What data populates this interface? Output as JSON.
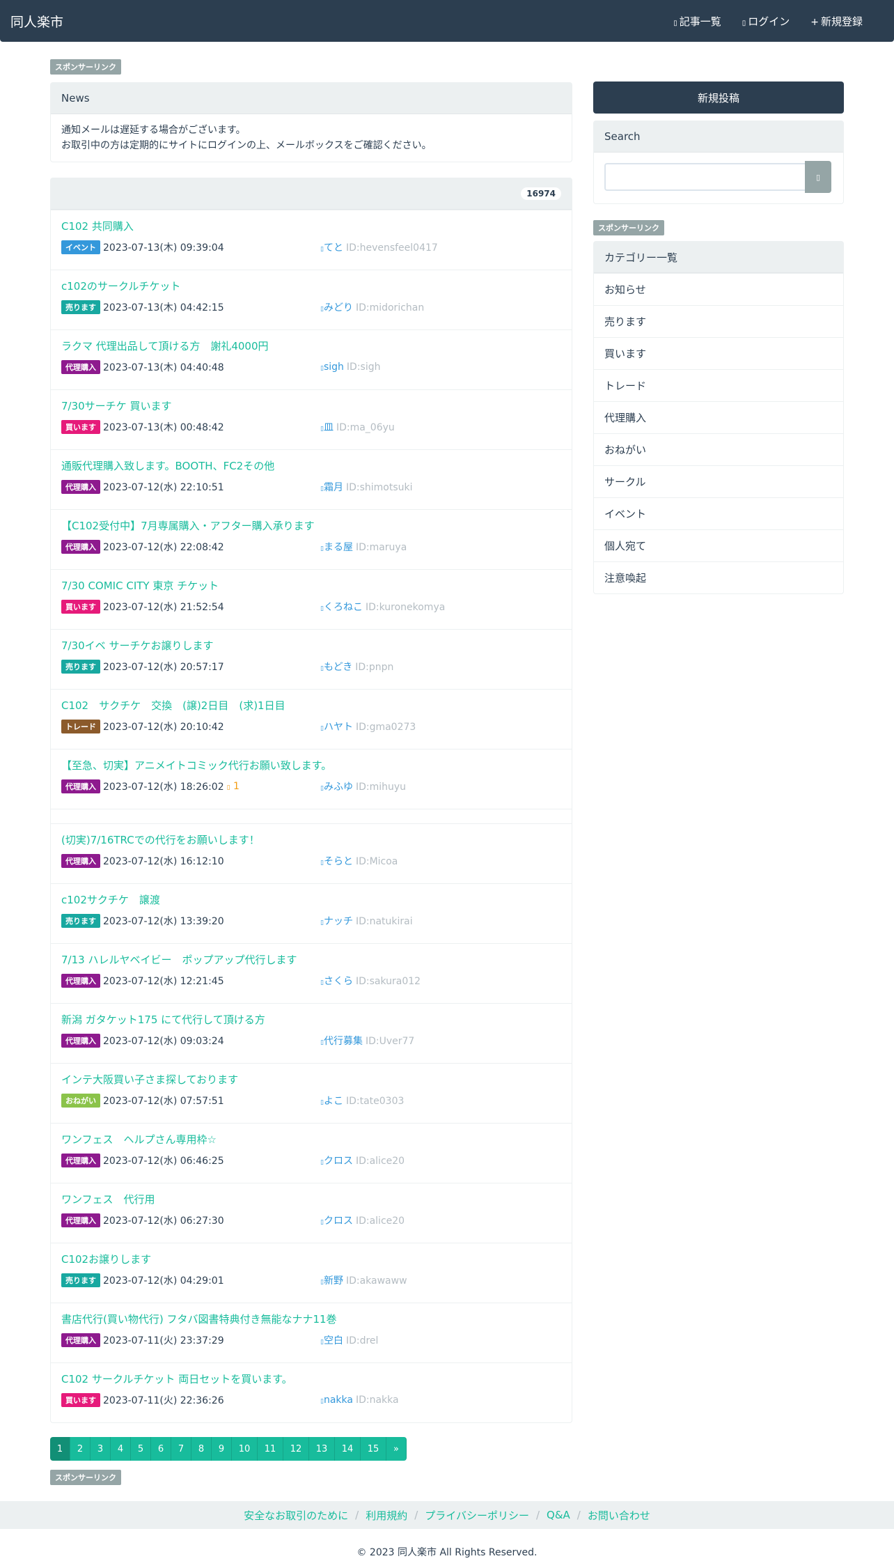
{
  "site": {
    "brand": "同人楽市"
  },
  "nav": [
    {
      "icon": "list-icon",
      "label": "記事一覧"
    },
    {
      "icon": "login-icon",
      "label": "ログイン"
    },
    {
      "icon": "plus-icon",
      "label": "新規登録"
    }
  ],
  "sponsor_label": "スポンサーリンク",
  "news": {
    "title": "News",
    "lines": [
      "通知メールは遅延する場合がございます。",
      "お取引中の方は定期的にサイトにログインの上、メールボックスをご確認ください。"
    ]
  },
  "post_count": "16974",
  "colors": {
    "event": "#3498db",
    "sell": "#18a8a0",
    "proxy": "#8e1a8e",
    "buy": "#e61a7a",
    "trade": "#8b5a2b",
    "wish": "#8bc34a",
    "primary": "#2c3e50",
    "accent": "#18bc9c"
  },
  "posts": [
    {
      "title": "C102 共同購入",
      "category": "イベント",
      "cat": "event",
      "date": "2023-07-13(木) 09:39:04",
      "user": "てと",
      "id": "ID:hevensfeel0417"
    },
    {
      "title": "c102のサークルチケット",
      "category": "売ります",
      "cat": "sell",
      "date": "2023-07-13(木) 04:42:15",
      "user": "みどり",
      "id": "ID:midorichan"
    },
    {
      "title": "ラクマ 代理出品して頂ける方　謝礼4000円",
      "category": "代理購入",
      "cat": "proxy",
      "date": "2023-07-13(木) 04:40:48",
      "user": "sigh",
      "id": "ID:sigh"
    },
    {
      "title": "7/30サーチケ 買います",
      "category": "買います",
      "cat": "buy",
      "date": "2023-07-13(木) 00:48:42",
      "user": "皿",
      "id": "ID:ma_06yu"
    },
    {
      "title": "通販代理購入致します。BOOTH、FC2その他",
      "category": "代理購入",
      "cat": "proxy",
      "date": "2023-07-12(水) 22:10:51",
      "user": "霜月",
      "id": "ID:shimotsuki"
    },
    {
      "title": "【C102受付中】7月専属購入・アフター購入承ります",
      "category": "代理購入",
      "cat": "proxy",
      "date": "2023-07-12(水) 22:08:42",
      "user": "まる屋",
      "id": "ID:maruya"
    },
    {
      "title": "7/30 COMIC CITY 東京 チケット",
      "category": "買います",
      "cat": "buy",
      "date": "2023-07-12(水) 21:52:54",
      "user": "くろねこ",
      "id": "ID:kuronekomya"
    },
    {
      "title": "7/30イベ サーチケお譲りします",
      "category": "売ります",
      "cat": "sell",
      "date": "2023-07-12(水) 20:57:17",
      "user": "もどき",
      "id": "ID:pnpn"
    },
    {
      "title": "C102　サクチケ　交換　(譲)2日目　(求)1日目",
      "category": "トレード",
      "cat": "trade",
      "date": "2023-07-12(水) 20:10:42",
      "user": "ハヤト",
      "id": "ID:gma0273"
    },
    {
      "title": "【至急、切実】アニメイトコミック代行お願い致します。",
      "category": "代理購入",
      "cat": "proxy",
      "date": "2023-07-12(水) 18:26:02",
      "comments": "1",
      "user": "みふゆ",
      "id": "ID:mihuyu"
    },
    {
      "title": "(切実)7/16TRCでの代行をお願いします！",
      "category": "代理購入",
      "cat": "proxy",
      "date": "2023-07-12(水) 16:12:10",
      "user": "そらと",
      "id": "ID:Micoa"
    },
    {
      "title": "c102サクチケ　譲渡",
      "category": "売ります",
      "cat": "sell",
      "date": "2023-07-12(水) 13:39:20",
      "user": "ナッチ",
      "id": "ID:natukirai"
    },
    {
      "title": "7/13 ハレルヤベイビー　ポップアップ代行します",
      "category": "代理購入",
      "cat": "proxy",
      "date": "2023-07-12(水) 12:21:45",
      "user": "さくら",
      "id": "ID:sakura012"
    },
    {
      "title": "新潟 ガタケット175 にて代行して頂ける方",
      "category": "代理購入",
      "cat": "proxy",
      "date": "2023-07-12(水) 09:03:24",
      "user": "代行募集",
      "id": "ID:Uver77"
    },
    {
      "title": "インテ大阪買い子さま探しております",
      "category": "おねがい",
      "cat": "wish",
      "date": "2023-07-12(水) 07:57:51",
      "user": "よこ",
      "id": "ID:tate0303"
    },
    {
      "title": "ワンフェス　ヘルプさん専用枠☆",
      "category": "代理購入",
      "cat": "proxy",
      "date": "2023-07-12(水) 06:46:25",
      "user": "クロス",
      "id": "ID:alice20"
    },
    {
      "title": "ワンフェス　代行用",
      "category": "代理購入",
      "cat": "proxy",
      "date": "2023-07-12(水) 06:27:30",
      "user": "クロス",
      "id": "ID:alice20"
    },
    {
      "title": "C102お譲りします",
      "category": "売ります",
      "cat": "sell",
      "date": "2023-07-12(水) 04:29:01",
      "user": "新野",
      "id": "ID:akawaww"
    },
    {
      "title": "書店代行(買い物代行) フタバ図書特典付き無能なナナ11巻",
      "category": "代理購入",
      "cat": "proxy",
      "date": "2023-07-11(火) 23:37:29",
      "user": "空白",
      "id": "ID:drel"
    },
    {
      "title": "C102 サークルチケット 両日セットを買います。",
      "category": "買います",
      "cat": "buy",
      "date": "2023-07-11(火) 22:36:26",
      "user": "nakka",
      "id": "ID:nakka"
    }
  ],
  "pagination": [
    "1",
    "2",
    "3",
    "4",
    "5",
    "6",
    "7",
    "8",
    "9",
    "10",
    "11",
    "12",
    "13",
    "14",
    "15",
    "»"
  ],
  "sidebar": {
    "new_post": "新規投稿",
    "search_title": "Search",
    "search_placeholder": "",
    "category_title": "カテゴリー一覧",
    "categories": [
      "お知らせ",
      "売ります",
      "買います",
      "トレード",
      "代理購入",
      "おねがい",
      "サークル",
      "イベント",
      "個人宛て",
      "注意喚起"
    ]
  },
  "footer": {
    "links": [
      "安全なお取引のために",
      "利用規約",
      "プライバシーポリシー",
      "Q&A",
      "お問い合わせ"
    ],
    "copyright": "© 2023 同人楽市 All Rights Reserved."
  }
}
